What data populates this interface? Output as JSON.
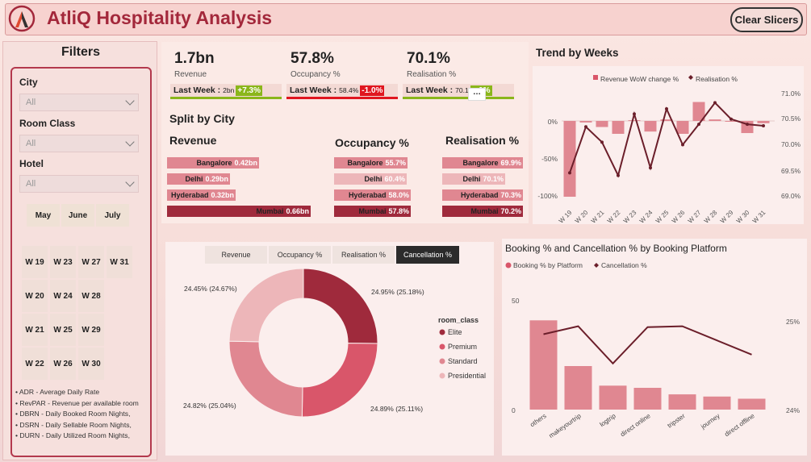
{
  "header": {
    "title": "AtliQ Hospitality Analysis",
    "clear_label": "Clear Slicers"
  },
  "filters": {
    "title": "Filters",
    "city_label": "City",
    "city_value": "All",
    "room_class_label": "Room Class",
    "room_class_value": "All",
    "hotel_label": "Hotel",
    "hotel_value": "All",
    "months": [
      "May",
      "June",
      "July"
    ],
    "weeks": [
      "W 19",
      "W 23",
      "W 27",
      "W 31",
      "W 20",
      "W 24",
      "W 28",
      "W 21",
      "W 25",
      "W 29",
      "W 22",
      "W 26",
      "W 30"
    ],
    "glossary": [
      "• ADR - Average Daily Rate",
      "• RevPAR - Revenue per available room",
      "• DBRN - Daily Booked Room Nights,",
      "• DSRN - Daily Sellable Room Nights,",
      "• DURN - Daily Utilized Room Nights,"
    ]
  },
  "kpis": [
    {
      "value": "1.7bn",
      "label": "Revenue",
      "lw_label": "Last Week :",
      "lw_value": "2bn",
      "change": "+7.3%",
      "change_color": "#8ab61a",
      "underline": "#8ab61a"
    },
    {
      "value": "57.8%",
      "label": "Occupancy %",
      "lw_label": "Last Week :",
      "lw_value": "58.4%",
      "change": "-1.0%",
      "change_color": "#e0161f",
      "underline": "#e0161f"
    },
    {
      "value": "70.1%",
      "label": "Realisation %",
      "lw_label": "Last Week :",
      "lw_value": "70.1",
      "change": "...0%",
      "change_color": "#8ab61a",
      "underline": "#8ab61a"
    }
  ],
  "split": {
    "title": "Split by City",
    "revenue": {
      "title": "Revenue",
      "rows": [
        {
          "city": "Bangalore",
          "value": "0.42bn",
          "frac": 0.64
        },
        {
          "city": "Delhi",
          "value": "0.29bn",
          "frac": 0.44
        },
        {
          "city": "Hyderabad",
          "value": "0.32bn",
          "frac": 0.48
        },
        {
          "city": "Mumbai",
          "value": "0.66bn",
          "frac": 1.0
        }
      ]
    },
    "occupancy": {
      "title": "Occupancy %",
      "rows": [
        {
          "city": "Bangalore",
          "value": "55.7%",
          "frac": 0.96
        },
        {
          "city": "Delhi",
          "value": "60.4%",
          "frac": 0.95
        },
        {
          "city": "Hyderabad",
          "value": "58.0%",
          "frac": 1.0
        },
        {
          "city": "Mumbai",
          "value": "57.8%",
          "frac": 1.0
        }
      ]
    },
    "realisation": {
      "title": "Realisation %",
      "rows": [
        {
          "city": "Bangalore",
          "value": "69.9%",
          "frac": 1.0
        },
        {
          "city": "Delhi",
          "value": "70.1%",
          "frac": 0.78
        },
        {
          "city": "Hyderabad",
          "value": "70.3%",
          "frac": 1.0
        },
        {
          "city": "Mumbai",
          "value": "70.2%",
          "frac": 1.0
        }
      ]
    }
  },
  "trend": {
    "title": "Trend by Weeks",
    "legend_bar": "Revenue WoW change %",
    "legend_line": "Realisation %",
    "left_ticks": [
      "0%",
      "-50%",
      "-100%"
    ],
    "right_ticks": [
      "71.0%",
      "70.5%",
      "70.0%",
      "69.5%",
      "69.0%"
    ]
  },
  "donut": {
    "tabs": [
      "Revenue",
      "Occupancy %",
      "Realisation %",
      "Cancellation %"
    ],
    "active_tab": 3,
    "legend_title": "room_class",
    "labels": [
      "24.95% (25.18%)",
      "24.89% (25.11%)",
      "24.82% (25.04%)",
      "24.45% (24.67%)"
    ]
  },
  "platform": {
    "title": "Booking % and Cancellation % by Booking Platform",
    "legend_bar": "Booking % by Platform",
    "legend_line": "Cancellation %",
    "left_ticks": [
      "50",
      "0"
    ],
    "right_ticks": [
      "25%",
      "24%"
    ]
  },
  "colors": {
    "dark": "#9f2a3c",
    "mid": "#d9566a",
    "light": "#e08791",
    "pale": "#edb6b9",
    "line": "#6b1e2a"
  },
  "chart_data": [
    {
      "type": "bar",
      "title": "Trend by Weeks",
      "categories": [
        "W 19",
        "W 20",
        "W 21",
        "W 22",
        "W 23",
        "W 24",
        "W 25",
        "W 26",
        "W 27",
        "W 28",
        "W 29",
        "W 30",
        "W 31"
      ],
      "series": [
        {
          "name": "Revenue WoW change %",
          "values": [
            -100,
            -2,
            -8,
            -17,
            1,
            -14,
            2,
            -17,
            25,
            2,
            0,
            -16,
            -3
          ]
        },
        {
          "name": "Realisation %",
          "values": [
            69.45,
            70.35,
            70.05,
            69.4,
            70.6,
            69.55,
            70.7,
            70.0,
            70.4,
            70.82,
            70.5,
            70.4,
            70.37
          ]
        }
      ],
      "ylim": [
        -100,
        30
      ],
      "y2lim": [
        69.0,
        71.0
      ]
    },
    {
      "type": "pie",
      "title": "",
      "categories": [
        "Elite",
        "Premium",
        "Standard",
        "Presidential"
      ],
      "values": [
        24.95,
        24.89,
        24.82,
        24.45
      ]
    },
    {
      "type": "bar",
      "title": "Booking % and Cancellation % by Booking Platform",
      "categories": [
        "others",
        "makeyourtrip",
        "logtrip",
        "direct online",
        "tripster",
        "journey",
        "direct offline"
      ],
      "series": [
        {
          "name": "Booking % by Platform",
          "values": [
            41,
            20,
            11,
            10,
            7,
            6,
            5
          ]
        },
        {
          "name": "Cancellation %",
          "values": [
            24.85,
            24.94,
            24.52,
            24.93,
            24.94,
            24.78,
            24.62
          ]
        }
      ],
      "ylim": [
        0,
        50
      ],
      "y2lim": [
        24.0,
        25.0
      ]
    }
  ]
}
